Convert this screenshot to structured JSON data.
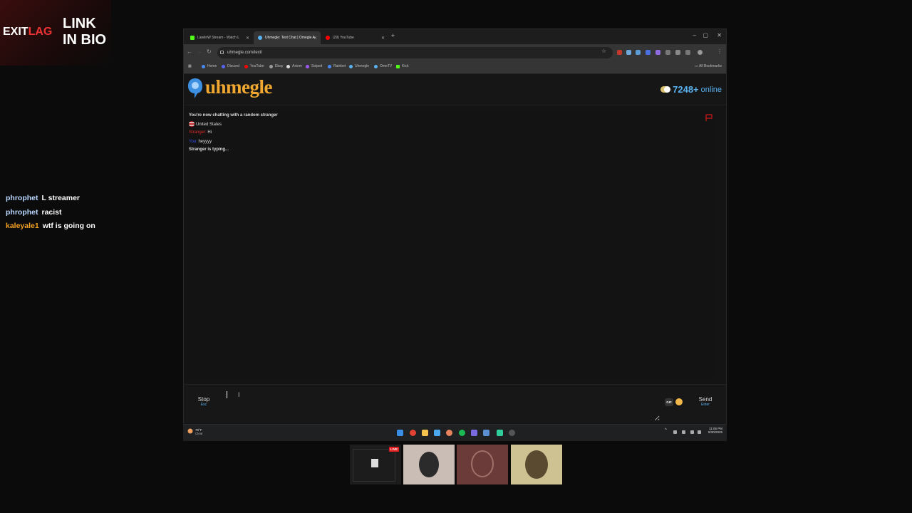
{
  "overlay": {
    "brand_exit": "EXIT",
    "brand_lag": "LAG",
    "link_bio_line1": "LINK",
    "link_bio_line2": "IN BIO",
    "chat": [
      {
        "user": "phrophet",
        "message": "L streamer",
        "color": "#b9d7ff"
      },
      {
        "user": "phrophet",
        "message": "racist",
        "color": "#b9d7ff"
      },
      {
        "user": "kaleyale1",
        "message": "wtf is going on",
        "color": "#f2a224"
      }
    ]
  },
  "browser": {
    "tabs": [
      {
        "label": "LawlinW Stream - Watch L",
        "favicon_color": "#53fc18"
      },
      {
        "label": "Uhmegle: Text Chat | Omegle A",
        "favicon_color": "#5ab2f0"
      },
      {
        "label": "(29) YouTube",
        "favicon_color": "#ff0000"
      }
    ],
    "new_tab": "+",
    "url": "uhmegle.com/text/",
    "bookmarks": [
      {
        "label": "Home",
        "color": "#4a8af4"
      },
      {
        "label": "Discord",
        "color": "#5865f2"
      },
      {
        "label": "YouTube",
        "color": "#ff0000"
      },
      {
        "label": "Ebay",
        "color": "#999999"
      },
      {
        "label": "Axiom",
        "color": "#dddddd"
      },
      {
        "label": "Solpeit",
        "color": "#9b59f0"
      },
      {
        "label": "Rainbet",
        "color": "#4a8af4"
      },
      {
        "label": "Uhmegle",
        "color": "#5ab2f0"
      },
      {
        "label": "OmeTV",
        "color": "#5ab2f0"
      },
      {
        "label": "Kick",
        "color": "#53fc18"
      }
    ],
    "all_bookmarks": "All Bookmarks"
  },
  "site": {
    "logo": "uhmegle",
    "online_count": "7248+",
    "online_label": "online",
    "status_line": "You're now chatting with a random stranger",
    "country": "United States",
    "messages": [
      {
        "sender": "Stranger:",
        "text": "Hi",
        "sender_color": "#e02a2a"
      },
      {
        "sender": "You:",
        "text": "heyyyy",
        "sender_color": "#3355ee"
      }
    ],
    "typing": "Stranger is typing...",
    "stop_label": "Stop",
    "stop_key": "Esc",
    "input_value": "",
    "gif_label": "GIF",
    "send_label": "Send",
    "send_key": "Enter"
  },
  "taskbar": {
    "weather_temp": "79°F",
    "weather_desc": "Clear",
    "time": "11:06 PM",
    "date": "8/30/2025"
  },
  "webcams": {
    "live_badge": "LIVE"
  }
}
